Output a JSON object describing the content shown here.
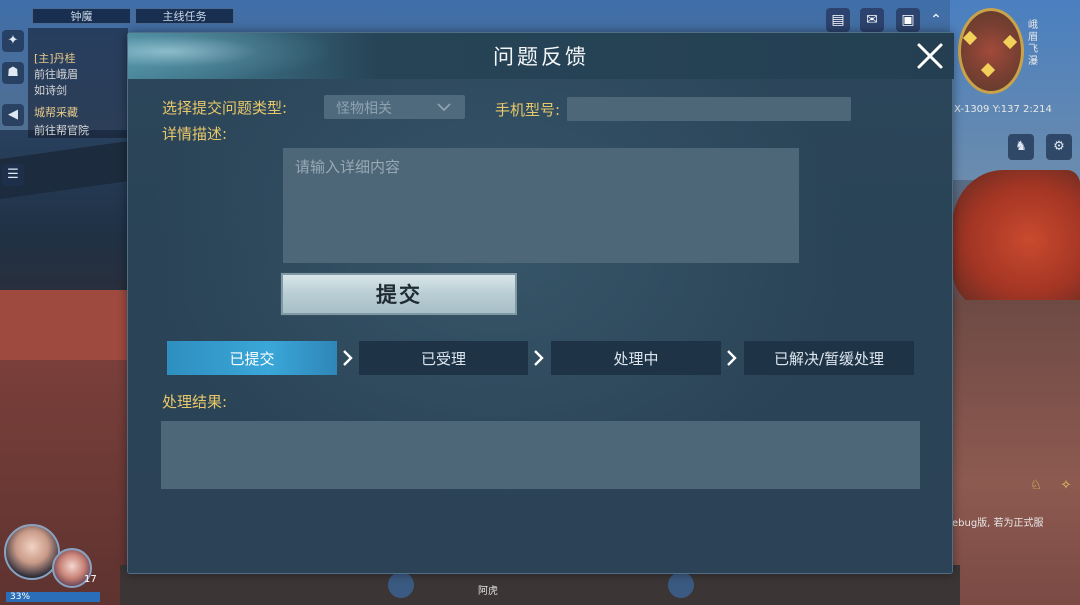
{
  "hud": {
    "quest_tabs": [
      "钟魔",
      "主线任务"
    ],
    "quest_lines": [
      "[主]丹桂",
      "前往峨眉",
      "如诗剑",
      "城帮采藏",
      "前往帮官院"
    ],
    "top_icons": [
      "book-icon",
      "mail-icon",
      "arrow-up-icon"
    ],
    "coords": "X-1309 Y:137 2:214",
    "map_label": "峨眉飞瀑",
    "stat_text": "33%",
    "level_badge": "17",
    "chat_text": "ebug版, 若为正式服",
    "bottom_labels": [
      "阿虎"
    ]
  },
  "dialog": {
    "title": "问题反馈",
    "close_icon": "close-icon",
    "type_label": "选择提交问题类型:",
    "type_value": "怪物相关",
    "phone_label": "手机型号:",
    "phone_value": "",
    "detail_label": "详情描述:",
    "detail_placeholder": "请输入详细内容",
    "submit_label": "提交",
    "steps": [
      {
        "label": "已提交",
        "active": true
      },
      {
        "label": "已受理",
        "active": false
      },
      {
        "label": "处理中",
        "active": false
      },
      {
        "label": "已解决/暂缓处理",
        "active": false
      }
    ],
    "result_label": "处理结果:",
    "result_value": ""
  },
  "colors": {
    "label_gold": "#e8c86a",
    "step_active": "#3aa7d8",
    "panel_bg": "#2c465b",
    "input_bg": "#4d6779"
  }
}
